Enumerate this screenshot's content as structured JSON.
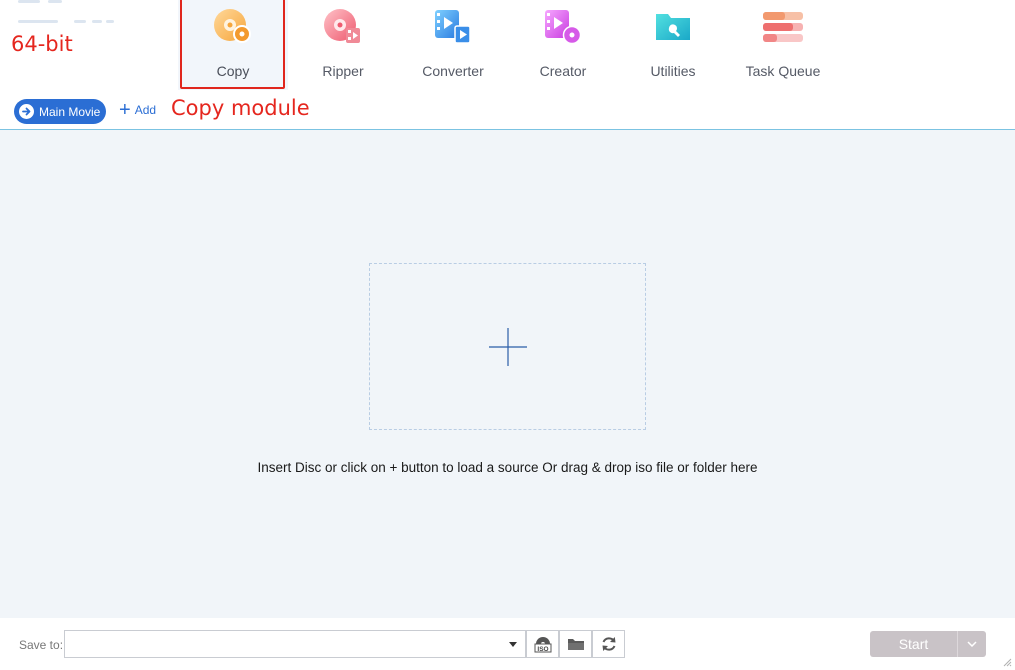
{
  "annotations": {
    "bitness": "64-bit",
    "copy_module": "Copy module"
  },
  "nav": {
    "items": [
      {
        "id": "copy",
        "label": "Copy",
        "icon": "copy-disc-icon",
        "active": true
      },
      {
        "id": "ripper",
        "label": "Ripper",
        "icon": "ripper-disc-icon",
        "active": false
      },
      {
        "id": "converter",
        "label": "Converter",
        "icon": "converter-video-icon",
        "active": false
      },
      {
        "id": "creator",
        "label": "Creator",
        "icon": "creator-video-disc-icon",
        "active": false
      },
      {
        "id": "utilities",
        "label": "Utilities",
        "icon": "utilities-folder-icon",
        "active": false
      },
      {
        "id": "task-queue",
        "label": "Task Queue",
        "icon": "task-queue-icon",
        "active": false
      }
    ]
  },
  "toolbar": {
    "main_movie_label": "Main Movie",
    "add_label": "Add"
  },
  "workspace": {
    "drop_hint": "Insert Disc or click on + button to load a source Or drag & drop iso file or folder here"
  },
  "bottom": {
    "save_to_label": "Save to:",
    "path_value": "",
    "iso_label": "ISO",
    "start_label": "Start"
  },
  "colors": {
    "accent": "#2b6ed4",
    "annotation_red": "#e5261e",
    "workspace_bg": "#f1f5f9",
    "start_disabled": "#c9c3c7"
  }
}
